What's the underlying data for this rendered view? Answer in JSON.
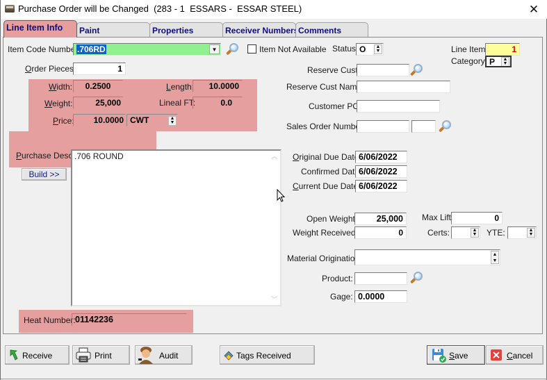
{
  "window": {
    "title": "Purchase Order will be Changed  (283 - 1  ESSARS -  ESSAR STEEL)",
    "close_glyph": "✕"
  },
  "tabs": [
    {
      "label": "Line Item Info",
      "active": true
    },
    {
      "label": "Paint",
      "active": false
    },
    {
      "label": "Properties",
      "active": false
    },
    {
      "label": "Receiver Numbers",
      "active": false
    },
    {
      "label": "Comments",
      "active": false
    }
  ],
  "line_item": {
    "item_code": {
      "label": "Item Code Number:",
      "value": ".706RD"
    },
    "item_not_available": {
      "label": "Item Not Available",
      "checked": false
    },
    "status": {
      "label": "Status:",
      "value": "O"
    },
    "line_item_no": {
      "label": "Line Item:",
      "value": "1"
    },
    "category": {
      "label": "Category:",
      "value": "P"
    },
    "order_pieces": {
      "label": "Order Pieces:",
      "value": "1"
    },
    "width": {
      "label": "Width:",
      "value": "0.2500"
    },
    "length": {
      "label": "Length:",
      "value": "10.0000"
    },
    "weight": {
      "label": "Weight:",
      "value": "25,000"
    },
    "lineal_ft": {
      "label": "Lineal FT:",
      "value": "0.0"
    },
    "price": {
      "label": "Price:",
      "value": "10.0000",
      "unit": "CWT"
    },
    "purchase_desc": {
      "label": "Purchase Desc:",
      "value": ".706 ROUND"
    },
    "build_button": "Build >>",
    "heat_number": {
      "label": "Heat Number:",
      "value": "01142236"
    }
  },
  "right": {
    "reserve_cust": {
      "label": "Reserve Cust:",
      "value": ""
    },
    "reserve_cust_name": {
      "label": "Reserve Cust Name:",
      "value": ""
    },
    "customer_po": {
      "label": "Customer PO:",
      "value": ""
    },
    "sales_order_number": {
      "label": "Sales Order Number:",
      "value": "",
      "value2": ""
    },
    "original_due_date": {
      "label": "Original Due Date:",
      "value": "6/06/2022"
    },
    "confirmed_date": {
      "label": "Confirmed Date:",
      "value": "6/06/2022"
    },
    "current_due_date": {
      "label": "Current Due Date:",
      "value": "6/06/2022"
    },
    "open_weight": {
      "label": "Open Weight:",
      "value": "25,000"
    },
    "max_lift": {
      "label": "Max Lift:",
      "value": "0"
    },
    "weight_received": {
      "label": "Weight Received:",
      "value": "0"
    },
    "certs": {
      "label": "Certs:",
      "value": ""
    },
    "yte": {
      "label": "YTE:",
      "value": ""
    },
    "material_origination": {
      "label": "Material Origination:",
      "value": ""
    },
    "product": {
      "label": "Product:",
      "value": ""
    },
    "gage": {
      "label": "Gage:",
      "value": "0.0000"
    }
  },
  "footer": {
    "receive": "Receive",
    "print": "Print",
    "audit": "Audit",
    "tags_received": "Tags Received",
    "save": "Save",
    "cancel": "Cancel"
  },
  "colors": {
    "highlight_pink": "#e59f9f",
    "item_code_bg": "#90f090",
    "line_item_bg": "#ffff99",
    "line_item_fg": "#e00000",
    "tab_text": "#0e0e7a",
    "selection": "#0a64c8"
  }
}
